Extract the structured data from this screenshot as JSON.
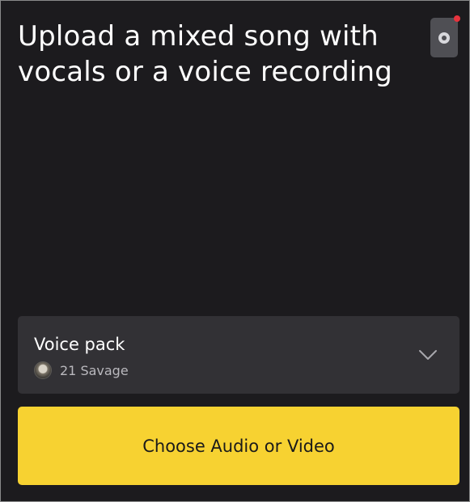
{
  "heading": "Upload a mixed song with vocals or a voice recording",
  "settings": {
    "icon": "gear-icon",
    "has_notification": true,
    "notification_color": "#e8333d"
  },
  "voice_pack": {
    "label": "Voice pack",
    "selected": "21 Savage",
    "icon": "chevron-down-icon"
  },
  "upload": {
    "label": "Choose Audio or Video"
  },
  "colors": {
    "background": "#1c1b1e",
    "card": "#323135",
    "accent": "#f7d231"
  }
}
